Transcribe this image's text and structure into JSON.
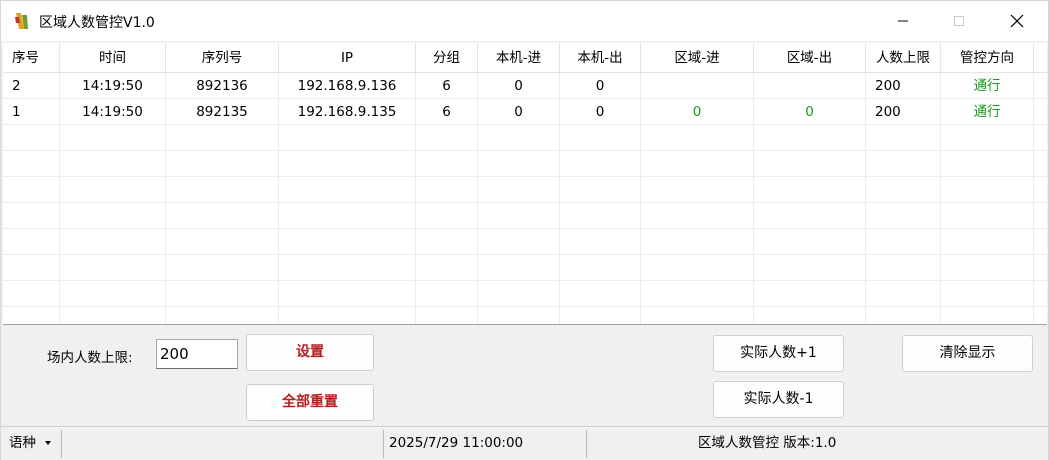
{
  "window": {
    "title": "区域人数管控V1.0",
    "icon": "app-logo-icon"
  },
  "grid": {
    "columns": [
      "序号",
      "时间",
      "序列号",
      "IP",
      "分组",
      "本机-进",
      "本机-出",
      "区域-进",
      "区域-出",
      "人数上限",
      "管控方向"
    ],
    "rows": [
      [
        "2",
        "14:19:50",
        "892136",
        "192.168.9.136",
        "6",
        "0",
        "0",
        "",
        "",
        "200",
        "通行"
      ],
      [
        "1",
        "14:19:50",
        "892135",
        "192.168.9.135",
        "6",
        "0",
        "0",
        "0",
        "0",
        "200",
        "通行"
      ]
    ]
  },
  "controls": {
    "limit_label": "场内人数上限:",
    "limit_value": "200",
    "set_label": "设置",
    "reset_all_label": "全部重置",
    "plus_label": "实际人数+1",
    "minus_label": "实际人数-1",
    "clear_label": "清除显示"
  },
  "status": {
    "language": "语种",
    "datetime": "2025/7/29 11:00:00",
    "version_text": "区域人数管控 版本:1.0"
  },
  "colors": {
    "accent_green": "#1a9a1a",
    "button_red": "#b3201e"
  }
}
